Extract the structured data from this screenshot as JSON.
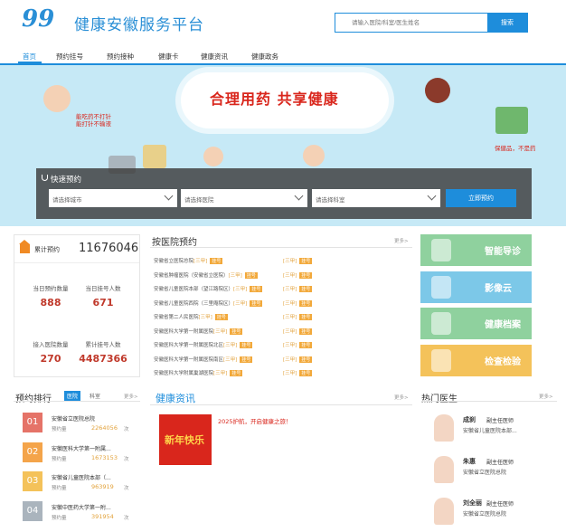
{
  "header": {
    "logo_mark": "99",
    "logo_text": "健康安徽服务平台",
    "search_placeholder": "请输入医院/科室/医生姓名",
    "search_button": "搜索"
  },
  "nav": [
    "首页",
    "预约挂号",
    "预约接种",
    "健康卡",
    "健康资讯",
    "健康政务"
  ],
  "banner": {
    "slogan": "合理用药  共享健康",
    "left_tip": "能吃药不打针\n能打针不输液",
    "right_tip": "保健品，不是药"
  },
  "booking": {
    "title": "快速预约",
    "city_placeholder": "请选择城市",
    "hospital_placeholder": "请选择医院",
    "dept_placeholder": "请选择科室",
    "submit": "立即预约"
  },
  "stats": {
    "total_label": "累计预约",
    "total_value": "11676046",
    "items": [
      {
        "label": "当日预约数量",
        "value": "888"
      },
      {
        "label": "当日挂号人数",
        "value": "671"
      },
      {
        "label": "接入医院数量",
        "value": "270"
      },
      {
        "label": "累计挂号人数",
        "value": "4487366"
      }
    ]
  },
  "hospitals": {
    "title": "按医院预约",
    "more": "更多>",
    "tag": "挂号",
    "left": [
      {
        "name": "安徽省立医院总院",
        "level": "[三甲]"
      },
      {
        "name": "安徽省肿瘤医院（安徽省立医院）",
        "level": "[三甲]"
      },
      {
        "name": "安徽省儿童医院本部（望江路院区）",
        "level": "[三甲]"
      },
      {
        "name": "安徽省儿童医院西院（三里庵院区）",
        "level": "[三甲]"
      },
      {
        "name": "安徽省第二人民医院",
        "level": "[三甲]"
      },
      {
        "name": "安徽医科大学第一附属医院",
        "level": "[三甲]"
      },
      {
        "name": "安徽医科大学第一附属医院北区",
        "level": "[三甲]"
      },
      {
        "name": "安徽医科大学第一附属医院南区",
        "level": "[三甲]"
      },
      {
        "name": "安徽医科大学附属巢湖医院",
        "level": "[三甲]"
      }
    ],
    "right": [
      {
        "name": "",
        "level": "[三甲]"
      },
      {
        "name": "",
        "level": "[三甲]"
      },
      {
        "name": "",
        "level": "[三甲]"
      },
      {
        "name": "",
        "level": "[三甲]"
      },
      {
        "name": "",
        "level": "[三甲]"
      },
      {
        "name": "",
        "level": "[三甲]"
      },
      {
        "name": "",
        "level": "[三甲]"
      },
      {
        "name": "",
        "level": "[三甲]"
      },
      {
        "name": "",
        "level": "[三甲]"
      }
    ]
  },
  "tiles": [
    {
      "label": "智能导诊",
      "color": "#8fd19e"
    },
    {
      "label": "影像云",
      "color": "#7cc8e8"
    },
    {
      "label": "健康档案",
      "color": "#8fd19e"
    },
    {
      "label": "检查检验",
      "color": "#f4c25a"
    }
  ],
  "ranking": {
    "title": "预约排行",
    "tab_active": "医院",
    "tab_other": "科室",
    "more": "更多>",
    "sub_label": "预约量",
    "unit": "次",
    "colors": [
      "#e57368",
      "#f4a44a",
      "#f4c25a",
      "#aab4bd"
    ],
    "items": [
      {
        "num": "01",
        "name": "安徽省立医院总院",
        "count": "2264056"
      },
      {
        "num": "02",
        "name": "安徽医科大学第一附属...",
        "count": "1673153"
      },
      {
        "num": "03",
        "name": "安徽省儿童医院本部（...",
        "count": "963919"
      },
      {
        "num": "04",
        "name": "安徽中医药大学第一附...",
        "count": "391954"
      }
    ]
  },
  "news": {
    "title": "健康资讯",
    "more": "更多>",
    "image_text": "新年快乐",
    "headline": "2025护航，开启健康之旅！",
    "summary": "",
    "items": [
      "",
      "",
      "",
      "",
      "",
      "",
      "",
      "",
      "",
      ""
    ]
  },
  "doctors": {
    "title": "热门医生",
    "more": "更多>",
    "items": [
      {
        "name": "成刹",
        "title": "副主任医师",
        "hospital": "安徽省儿童医院本部..."
      },
      {
        "name": "朱惠",
        "title": "副主任医师",
        "hospital": "安徽省立医院总院"
      },
      {
        "name": "刘全丽",
        "title": "副主任医师",
        "hospital": "安徽省立医院总院"
      }
    ]
  }
}
